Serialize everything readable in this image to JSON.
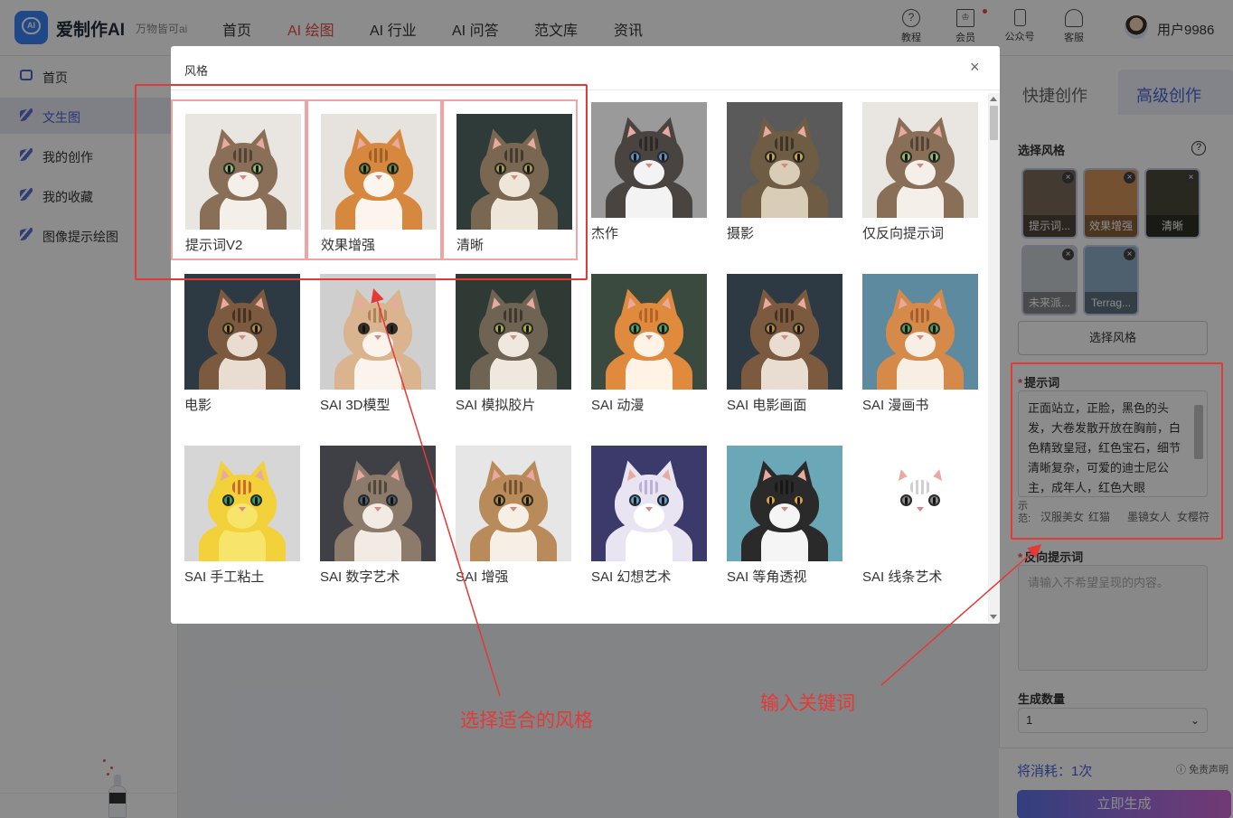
{
  "app": {
    "logo_mark": "AI",
    "logo_text": "爱制作AI",
    "slogan": "万物皆可ai"
  },
  "nav": [
    {
      "label": "首页",
      "active": false
    },
    {
      "label": "AI 绘图",
      "active": true
    },
    {
      "label": "AI 行业",
      "active": false
    },
    {
      "label": "AI 问答",
      "active": false
    },
    {
      "label": "范文库",
      "active": false
    },
    {
      "label": "资讯",
      "active": false
    }
  ],
  "top_actions": [
    {
      "label": "教程",
      "icon": "question-icon"
    },
    {
      "label": "会员",
      "icon": "crown-icon"
    },
    {
      "label": "公众号",
      "icon": "phone-icon"
    },
    {
      "label": "客服",
      "icon": "headset-icon"
    }
  ],
  "user": {
    "name": "用户9986"
  },
  "sidebar": {
    "items": [
      {
        "label": "首页",
        "icon": "chat-icon",
        "active": false
      },
      {
        "label": "文生图",
        "icon": "layers-icon",
        "active": true
      },
      {
        "label": "我的创作",
        "icon": "layers-icon",
        "active": false
      },
      {
        "label": "我的收藏",
        "icon": "layers-icon",
        "active": false
      },
      {
        "label": "图像提示绘图",
        "icon": "layers-icon",
        "active": false
      }
    ]
  },
  "right_panel": {
    "tabs": [
      {
        "label": "快捷创作",
        "active": false
      },
      {
        "label": "高级创作",
        "active": true
      }
    ],
    "style_section_title": "选择风格",
    "selected_styles": [
      "提示词...",
      "效果增强",
      "清晰",
      "未来派...",
      "Terrag..."
    ],
    "choose_style_button": "选择风格",
    "prompt": {
      "label": "提示词",
      "value": "正面站立，正脸，黑色的头发，大卷发散开放在胸前，白色精致皇冠，红色宝石，细节清晰复杂，可爱的迪士尼公主，成年人，红色大眼",
      "examples_label": "示范:",
      "examples": [
        "汉服美女",
        "红猫",
        "墨镜女人",
        "女樱符"
      ]
    },
    "negative_prompt": {
      "label": "反向提示词",
      "placeholder": "请输入不希望呈现的内容。"
    },
    "count": {
      "label": "生成数量",
      "value": "1"
    },
    "cost": "将消耗：1次",
    "disclaimer": "免责声明",
    "generate_button": "立即生成"
  },
  "modal": {
    "title": "风格",
    "close": "×",
    "styles": [
      {
        "name": "提示词V2",
        "selected": true
      },
      {
        "name": "效果增强",
        "selected": true
      },
      {
        "name": "清晰",
        "selected": true
      },
      {
        "name": "杰作",
        "selected": false
      },
      {
        "name": "摄影",
        "selected": false
      },
      {
        "name": "仅反向提示词",
        "selected": false
      },
      {
        "name": "电影",
        "selected": false
      },
      {
        "name": "SAI 3D模型",
        "selected": false
      },
      {
        "name": "SAI 模拟胶片",
        "selected": false
      },
      {
        "name": "SAI 动漫",
        "selected": false
      },
      {
        "name": "SAI 电影画面",
        "selected": false
      },
      {
        "name": "SAI 漫画书",
        "selected": false
      },
      {
        "name": "SAI 手工粘土",
        "selected": false
      },
      {
        "name": "SAI 数字艺术",
        "selected": false
      },
      {
        "name": "SAI 增强",
        "selected": false
      },
      {
        "name": "SAI 幻想艺术",
        "selected": false
      },
      {
        "name": "SAI 等角透视",
        "selected": false
      },
      {
        "name": "SAI 线条艺术",
        "selected": false
      }
    ]
  },
  "annotations": {
    "select_style": "选择适合的风格",
    "enter_keywords": "输入关键词",
    "highlight_color": "#e53935"
  }
}
